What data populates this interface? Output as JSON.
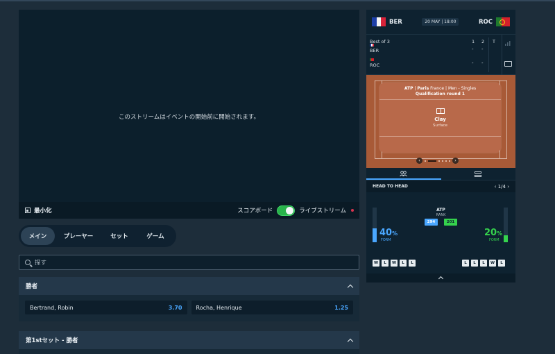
{
  "video": {
    "message": "このストリームはイベントの開始前に開始されます。",
    "minimize_label": "最小化",
    "scoreboard_label": "スコアボード",
    "live_stream_label": "ライブストリーム",
    "scoreboard_on": true
  },
  "tabs": [
    {
      "label": "メイン",
      "active": true
    },
    {
      "label": "プレーヤー",
      "active": false
    },
    {
      "label": "セット",
      "active": false
    },
    {
      "label": "ゲーム",
      "active": false
    }
  ],
  "search": {
    "placeholder": "探す"
  },
  "markets": [
    {
      "title": "勝者",
      "outcomes": [
        {
          "name": "Bertrand, Robin",
          "price": "3.70"
        },
        {
          "name": "Rocha, Henrique",
          "price": "1.25"
        }
      ]
    },
    {
      "title": "第1stセット - 勝者",
      "outcomes": []
    }
  ],
  "match": {
    "home_code": "BER",
    "away_code": "ROC",
    "datetime": "20 MAY | 18:00",
    "best_of": "Best of 3",
    "set_headers": [
      "1",
      "2",
      "T"
    ],
    "home_scores": [
      "-",
      "-"
    ],
    "away_scores": [
      "-",
      "-"
    ],
    "tour": "ATP",
    "city": "Paris",
    "country": "France",
    "category": "Men - Singles",
    "round": "Qualification round 1",
    "surface": "Clay",
    "surface_label": "Surface"
  },
  "h2h": {
    "title": "HEAD TO HEAD",
    "page": "1/4",
    "tour": "ATP",
    "rank_label": "RANK",
    "home_rank": "294",
    "away_rank": "201",
    "home_form_pct": "40",
    "away_form_pct": "20",
    "pct_symbol": "%",
    "form_label": "FORM",
    "home_form": [
      "W",
      "L",
      "W",
      "L",
      "L"
    ],
    "away_form": [
      "L",
      "L",
      "L",
      "W",
      "L"
    ]
  },
  "colors": {
    "accent_blue": "#4aa7ff",
    "accent_green": "#35d34d",
    "toggle_green": "#29b34b"
  }
}
